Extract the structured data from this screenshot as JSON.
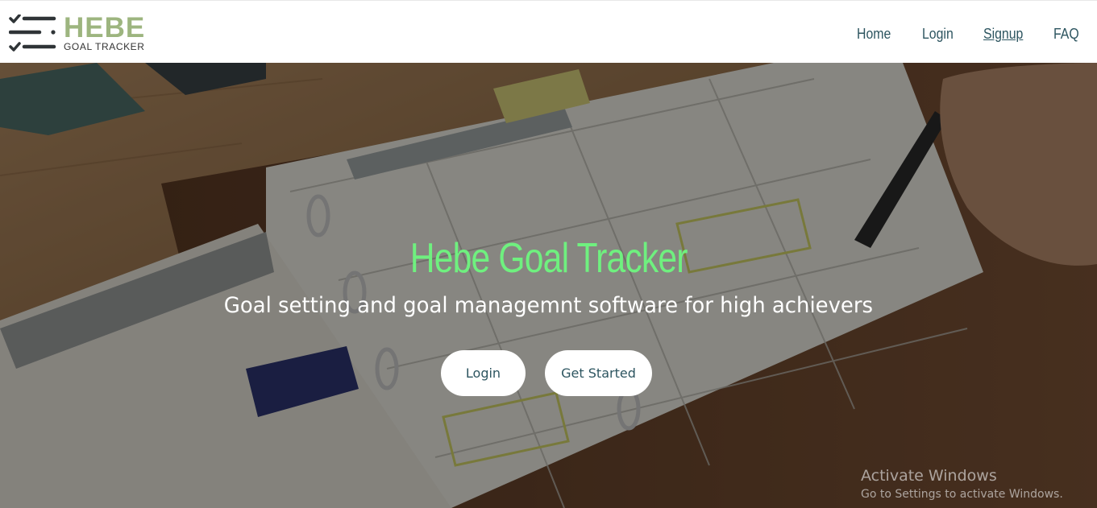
{
  "header": {
    "logo": {
      "title": "HEBE",
      "subtitle": "GOAL TRACKER"
    },
    "nav": [
      {
        "label": "Home"
      },
      {
        "label": "Login"
      },
      {
        "label": "Signup",
        "active": true
      },
      {
        "label": "FAQ"
      }
    ]
  },
  "hero": {
    "title": "Hebe Goal Tracker",
    "subtitle": "Goal setting and goal managemnt software for high achievers",
    "buttons": {
      "login": "Login",
      "get_started": "Get Started"
    }
  },
  "watermark": {
    "title": "Activate Windows",
    "subtitle": "Go to Settings to activate Windows."
  },
  "colors": {
    "brand_green": "#9db57f",
    "hero_title": "#6ff07f",
    "nav_text": "#2d5560",
    "header_bg": "#ffffff"
  },
  "icons": {
    "logo_mark": "checklist-icon"
  }
}
